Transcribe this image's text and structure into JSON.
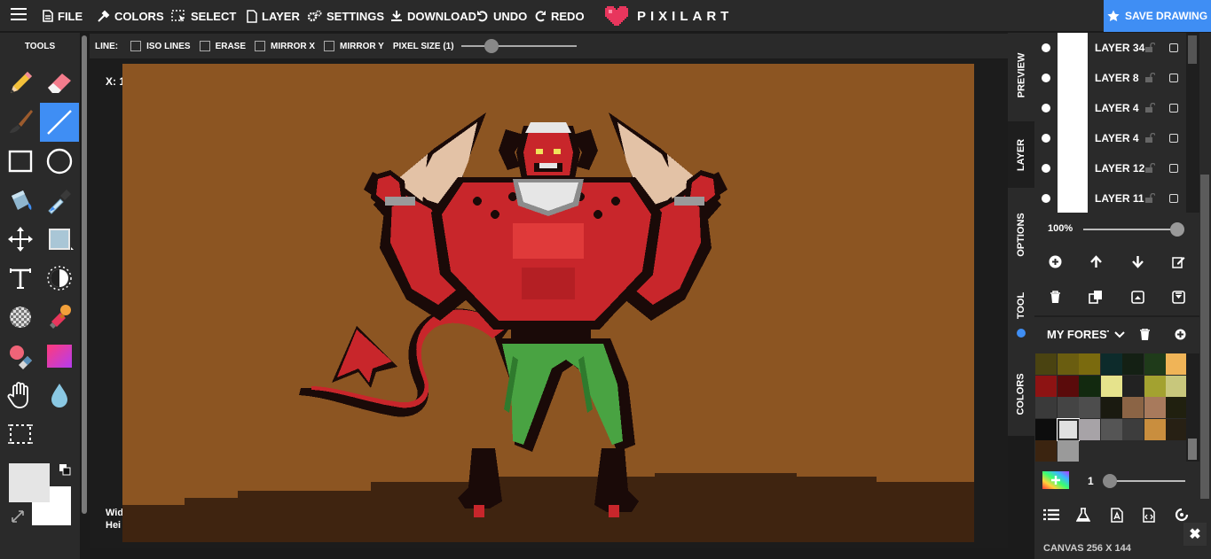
{
  "topbar": {
    "menu_items": [
      {
        "label": "FILE",
        "icon": "file-icon"
      },
      {
        "label": "COLORS",
        "icon": "eyedropper-icon"
      },
      {
        "label": "SELECT",
        "icon": "select-icon"
      },
      {
        "label": "LAYER",
        "icon": "layer-file-icon"
      },
      {
        "label": "SETTINGS",
        "icon": "gears-icon"
      },
      {
        "label": "DOWNLOAD",
        "icon": "download-icon"
      },
      {
        "label": "UNDO",
        "icon": "undo-icon"
      },
      {
        "label": "REDO",
        "icon": "redo-icon"
      }
    ],
    "brand": "PIXILART",
    "save_label": "SAVE DRAWING",
    "accent": "#3f8ef4",
    "brand_heart_color": "#e8365d"
  },
  "tools": {
    "title": "TOOLS",
    "items": [
      "pencil",
      "eraser",
      "paint-brush",
      "line",
      "rectangle",
      "ellipse",
      "bucket",
      "eyedropper",
      "move",
      "fill-shape",
      "text",
      "lighten",
      "dither",
      "stamp",
      "color-replace",
      "gradient",
      "hand",
      "blur-drop",
      "select-rect"
    ],
    "active": "line",
    "primary_color": "#e5e5e5",
    "secondary_color": "#ffffff"
  },
  "options": {
    "line_label": "LINE:",
    "checkboxes": [
      "ISO LINES",
      "ERASE",
      "MIRROR X",
      "MIRROR Y"
    ],
    "pixel_size_label": "PIXEL SIZE (1)",
    "pixel_size_value": 1
  },
  "canvas": {
    "coord_label": "X: 1",
    "dims_line1": "Wid",
    "dims_line2": "Hei",
    "bg_color": "#8c5522",
    "ground_color": "#3f2410"
  },
  "side_tabs": [
    "PREVIEW",
    "LAYER",
    "OPTIONS",
    "TOOL",
    "COLORS"
  ],
  "layers": [
    {
      "name": "LAYER 34"
    },
    {
      "name": "LAYER 8"
    },
    {
      "name": "LAYER 4"
    },
    {
      "name": "LAYER 4"
    },
    {
      "name": "LAYER 12"
    },
    {
      "name": "LAYER 11"
    }
  ],
  "layer_opacity": "100%",
  "layer_actions": [
    "add-icon",
    "move-up-icon",
    "move-down-icon",
    "edit-icon",
    "delete-icon",
    "duplicate-icon",
    "merge-up-icon",
    "merge-down-icon"
  ],
  "palette": {
    "name": "MY FORESTS",
    "colors": [
      "#4a4311",
      "#6a5d10",
      "#7a6a0e",
      "#0d2b2b",
      "#142014",
      "#1f3b1a",
      "#f0b457",
      "#8d1313",
      "#5a0b0b",
      "#12290f",
      "#e6e38c",
      "#222222",
      "#a3a230",
      "#c8c77c",
      "#3a3a3a",
      "#444444",
      "#4d4d4d",
      "#1a1a10",
      "#8b6445",
      "#a87a5c",
      "#20200f",
      "#0d0d0d",
      "#e0e0e0",
      "#a7a3a7",
      "#555555",
      "#3d3d3d",
      "#c98e3e",
      "#272014",
      "#3b2410",
      "#9a9a9a"
    ],
    "selected_index": 22
  },
  "brush_size": "1",
  "canvas_info": "CANVAS 256 X 144",
  "bottom_icons": [
    "layers-list-icon",
    "flask-icon",
    "file-a-icon",
    "file-code-icon",
    "spinner-icon"
  ]
}
